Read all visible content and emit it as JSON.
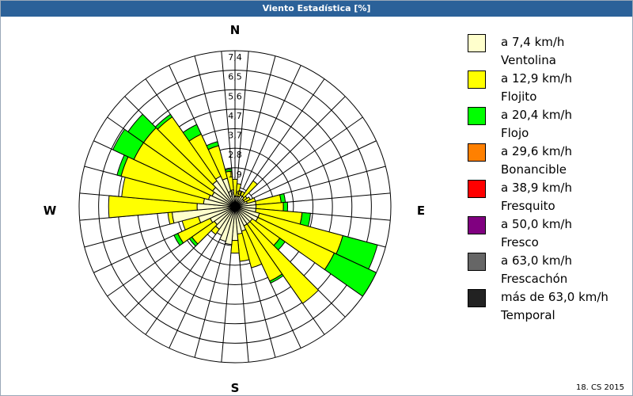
{
  "title": "Viento Estadística [%]",
  "footer": "18. CS 2015",
  "chart_data": {
    "type": "wind-rose",
    "title": "Viento Estadística [%]",
    "cardinals": [
      "N",
      "E",
      "S",
      "W"
    ],
    "rlim": [
      0,
      7.4
    ],
    "ring_labels": [
      "0,9",
      "1,9",
      "2,8",
      "3,7",
      "4,7",
      "5,6",
      "6,5",
      "7,4"
    ],
    "grid": true,
    "legend_position": "right",
    "directions": [
      0,
      10,
      20,
      30,
      40,
      50,
      60,
      70,
      80,
      90,
      100,
      110,
      120,
      130,
      140,
      150,
      160,
      170,
      180,
      190,
      200,
      210,
      220,
      230,
      240,
      250,
      260,
      270,
      280,
      290,
      300,
      310,
      320,
      330,
      340,
      350
    ],
    "series": [
      {
        "name": "Ventolina",
        "range": "a 7,4 km/h",
        "color": "#ffffcc",
        "values": [
          0.5,
          0.5,
          0.5,
          0.6,
          0.6,
          0.5,
          0.5,
          0.6,
          1.0,
          1.0,
          1.0,
          1.2,
          1.2,
          1.0,
          1.0,
          1.0,
          1.2,
          1.3,
          1.6,
          1.8,
          1.7,
          1.5,
          1.3,
          1.2,
          1.3,
          1.8,
          3.0,
          1.8,
          1.5,
          1.3,
          1.2,
          1.3,
          1.5,
          1.6,
          1.4,
          0.8
        ]
      },
      {
        "name": "Flojito",
        "range": "a 12,9 km/h",
        "color": "#ffff00",
        "values": [
          0.8,
          0.6,
          0.3,
          0.2,
          0.9,
          0.2,
          0.3,
          0.4,
          1.2,
          1.3,
          2.2,
          4.1,
          4.0,
          1.6,
          4.6,
          2.9,
          1.8,
          1.3,
          0.6,
          0,
          0,
          0,
          0.3,
          1.3,
          1.7,
          0.8,
          0.2,
          4.2,
          3.9,
          4.3,
          4.1,
          4.0,
          3.7,
          2.2,
          1.6,
          0.9
        ]
      },
      {
        "name": "Flojo",
        "range": "a 20,4 km/h",
        "color": "#00ff00",
        "values": [
          0,
          0,
          0,
          0,
          0,
          0,
          0,
          0,
          0.2,
          0.2,
          0.4,
          1.7,
          2.2,
          0.3,
          0,
          0.1,
          0,
          0,
          0,
          0,
          0,
          0,
          0,
          0.15,
          0.2,
          0,
          0,
          0,
          0,
          0.2,
          1.1,
          0.9,
          0.15,
          0.5,
          0.2,
          0.1
        ]
      },
      {
        "name": "Bonancible",
        "range": "a 29,6 km/h",
        "color": "#ff8000",
        "values": []
      },
      {
        "name": "Fresquito",
        "range": "a 38,9 km/h",
        "color": "#ff0000",
        "values": []
      },
      {
        "name": "Fresco",
        "range": "a 50,0 km/h",
        "color": "#800080",
        "values": []
      },
      {
        "name": "Frescachón",
        "range": "a 63,0 km/h",
        "color": "#666666",
        "values": []
      },
      {
        "name": "Temporal",
        "range": "más de 63,0 km/h",
        "color": "#222222",
        "values": []
      }
    ]
  }
}
